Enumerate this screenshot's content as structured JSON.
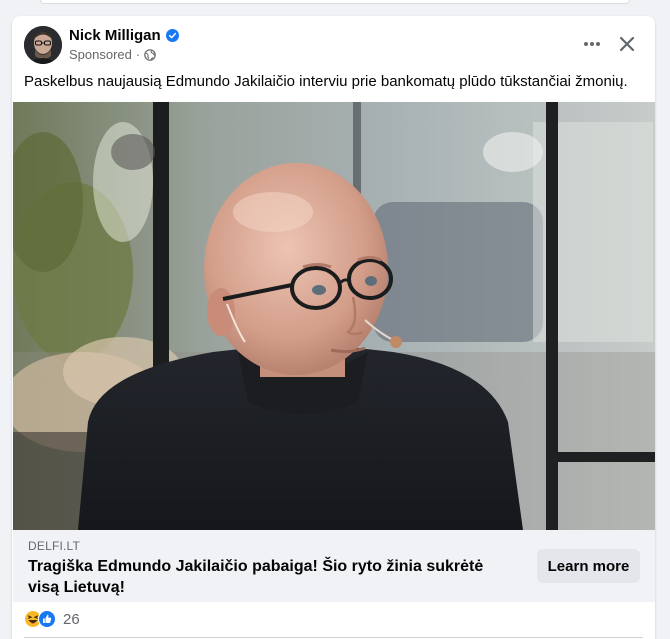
{
  "post": {
    "author": "Nick Milligan",
    "sponsored_label": "Sponsored",
    "separator": "·",
    "caption": "Paskelbus naujausią Edmundo Jakilaičio interviu prie bankomatų plūdo tūkstančiai žmonių."
  },
  "link_preview": {
    "domain": "DELFI.LT",
    "headline": "Tragiška Edmundo Jakilaičio pabaiga! Šio ryto žinia sukrėtė visą Lietuvą!",
    "cta_label": "Learn more"
  },
  "reactions": {
    "types": [
      "haha",
      "like"
    ],
    "count": "26"
  },
  "icons": {
    "verified": "verified-badge-icon",
    "audience": "globe-icon",
    "more": "more-options-icon",
    "close": "close-icon"
  },
  "colors": {
    "verified_blue": "#1877f2",
    "like_blue": "#1877f2",
    "haha_yellow": "#f7b928",
    "secondary_text": "#65676b",
    "button_grey": "#e4e6eb"
  }
}
